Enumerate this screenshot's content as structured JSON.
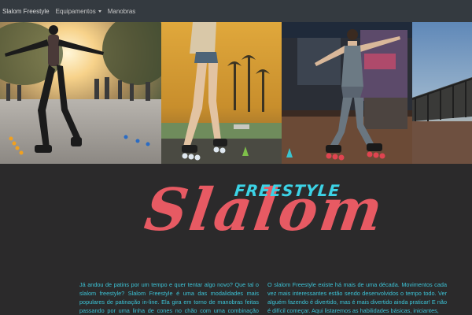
{
  "navbar": {
    "brand": "Slalom Freestyle",
    "links": [
      {
        "label": "Equipamentos",
        "has_dropdown": true
      },
      {
        "label": "Manobras",
        "has_dropdown": false
      }
    ]
  },
  "hero": {
    "subtitle": "FREESTYLE",
    "title": "Slalom",
    "subtitle_color": "#3cd3e6",
    "title_color": "#e75a63"
  },
  "intro": {
    "left": "Já andou de patins por um tempo e quer tentar algo novo? Que tal o slalom freestyle? Slalom Freestyle é uma das modalidades mais populares de patinação in-line. Ela gira em torno de manobras feitas passando por uma linha de cones no chão com uma combinação infinita",
    "right": "O slalom Freestyle existe há mais de uma década. Movimentos cada vez mais interessantes estão sendo desenvolvidos o tempo todo. Ver alguém fazendo é divertido, mas é mais divertido ainda praticar! E não é difícil começar. Aqui listaremos as habilidades básicas, iniciantes,"
  },
  "colors": {
    "navbar": "#343a40",
    "background": "#2b2a2b",
    "body_text": "#3cc3d6"
  }
}
